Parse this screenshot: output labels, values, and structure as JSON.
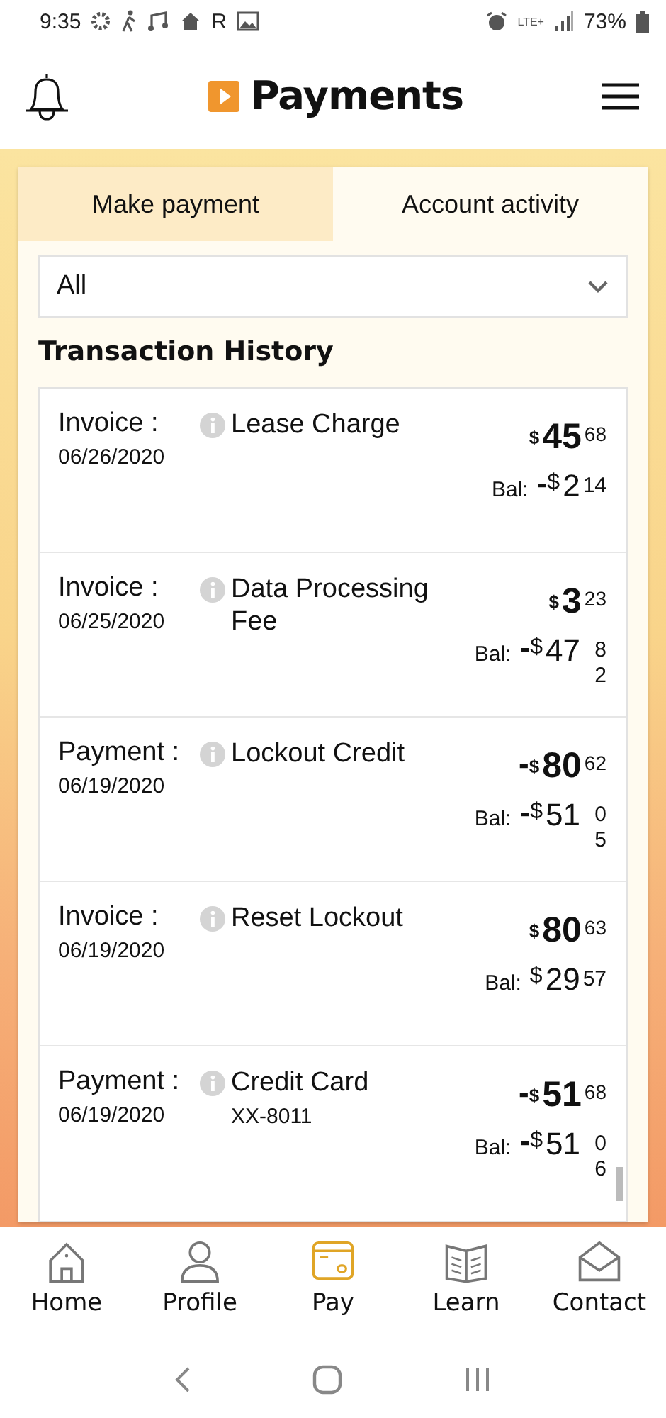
{
  "status_bar": {
    "time": "9:35",
    "carrier_mark": "R",
    "network": "LTE+",
    "battery": "73%"
  },
  "header": {
    "title": "Payments"
  },
  "tabs": [
    {
      "label": "Make payment",
      "selected": false
    },
    {
      "label": "Account activity",
      "selected": true
    }
  ],
  "filter": {
    "value": "All"
  },
  "section_title": "Transaction History",
  "transactions": [
    {
      "type": "Invoice :",
      "date": "06/26/2020",
      "description": "Lease Charge",
      "amount": {
        "symbol": "$",
        "whole": "45",
        "cents": "68"
      },
      "balance_label": "Bal:",
      "balance": {
        "sign": "-",
        "symbol": "$",
        "whole": "2",
        "cents": "14"
      }
    },
    {
      "type": "Invoice :",
      "date": "06/25/2020",
      "description": "Data Processing Fee",
      "amount": {
        "symbol": "$",
        "whole": "3",
        "cents": "23"
      },
      "balance_label": "Bal:",
      "balance": {
        "sign": "-",
        "symbol": "$",
        "whole": "47",
        "cents": "82"
      }
    },
    {
      "type": "Payment :",
      "date": "06/19/2020",
      "description": "Lockout Credit",
      "amount": {
        "sign": "-",
        "symbol": "$",
        "whole": "80",
        "cents": "62"
      },
      "balance_label": "Bal:",
      "balance": {
        "sign": "-",
        "symbol": "$",
        "whole": "51",
        "cents": "05"
      }
    },
    {
      "type": "Invoice :",
      "date": "06/19/2020",
      "description": "Reset Lockout",
      "amount": {
        "symbol": "$",
        "whole": "80",
        "cents": "63"
      },
      "balance_label": "Bal:",
      "balance": {
        "symbol": "$",
        "whole": "29",
        "cents": "57"
      }
    },
    {
      "type": "Payment :",
      "date": "06/19/2020",
      "description": "Credit Card",
      "detail": "XX-8011",
      "amount": {
        "sign": "-",
        "symbol": "$",
        "whole": "51",
        "cents": "68"
      },
      "balance_label": "Bal:",
      "balance": {
        "sign": "-",
        "symbol": "$",
        "whole": "51",
        "cents": "06"
      }
    }
  ],
  "bottom_nav": [
    {
      "label": "Home",
      "selected": false
    },
    {
      "label": "Profile",
      "selected": false
    },
    {
      "label": "Pay",
      "selected": true
    },
    {
      "label": "Learn",
      "selected": false
    },
    {
      "label": "Contact",
      "selected": false
    }
  ]
}
